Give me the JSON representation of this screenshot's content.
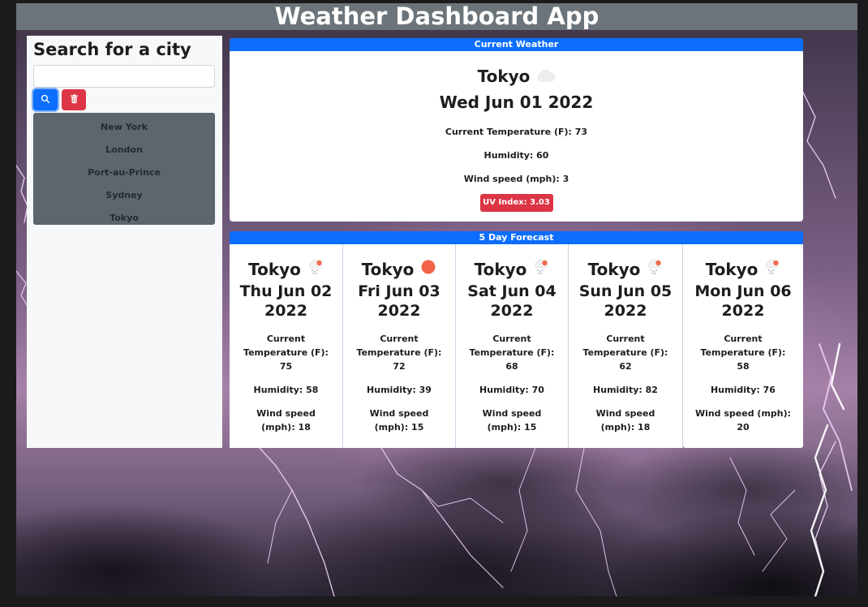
{
  "app": {
    "title": "Weather Dashboard App"
  },
  "sidebar": {
    "heading": "Search for a city",
    "search_placeholder": "",
    "search_value": "",
    "search_icon": "search-icon",
    "delete_icon": "trash-icon",
    "history": [
      "New York",
      "London",
      "Port-au-Prince",
      "Sydney",
      "Tokyo"
    ]
  },
  "current": {
    "header": "Current Weather",
    "city": "Tokyo",
    "icon": "cloud-icon",
    "date": "Wed Jun 01 2022",
    "temperature": "Current Temperature (F): 73",
    "humidity": "Humidity: 60",
    "wind": "Wind speed (mph): 3",
    "uv": "UV Index: 3.03"
  },
  "forecast": {
    "header": "5 Day Forecast",
    "days": [
      {
        "city": "Tokyo",
        "icon": "rain-icon",
        "date": "Thu Jun 02 2022",
        "temperature": "Current Temperature (F): 75",
        "humidity": "Humidity: 58",
        "wind": "Wind speed (mph): 18"
      },
      {
        "city": "Tokyo",
        "icon": "sun-icon",
        "date": "Fri Jun 03 2022",
        "temperature": "Current Temperature (F): 72",
        "humidity": "Humidity: 39",
        "wind": "Wind speed (mph): 15"
      },
      {
        "city": "Tokyo",
        "icon": "rain-icon",
        "date": "Sat Jun 04 2022",
        "temperature": "Current Temperature (F): 68",
        "humidity": "Humidity: 70",
        "wind": "Wind speed (mph): 15"
      },
      {
        "city": "Tokyo",
        "icon": "rain-icon",
        "date": "Sun Jun 05 2022",
        "temperature": "Current Temperature (F): 62",
        "humidity": "Humidity: 82",
        "wind": "Wind speed (mph): 18"
      },
      {
        "city": "Tokyo",
        "icon": "rain-icon",
        "date": "Mon Jun 06 2022",
        "temperature": "Current Temperature (F): 58",
        "humidity": "Humidity: 76",
        "wind": "Wind speed (mph): 20"
      }
    ]
  },
  "colors": {
    "header_bg": "#6b747a",
    "primary": "#0d6efd",
    "danger": "#dc3545",
    "history_bg": "#5e666d"
  }
}
